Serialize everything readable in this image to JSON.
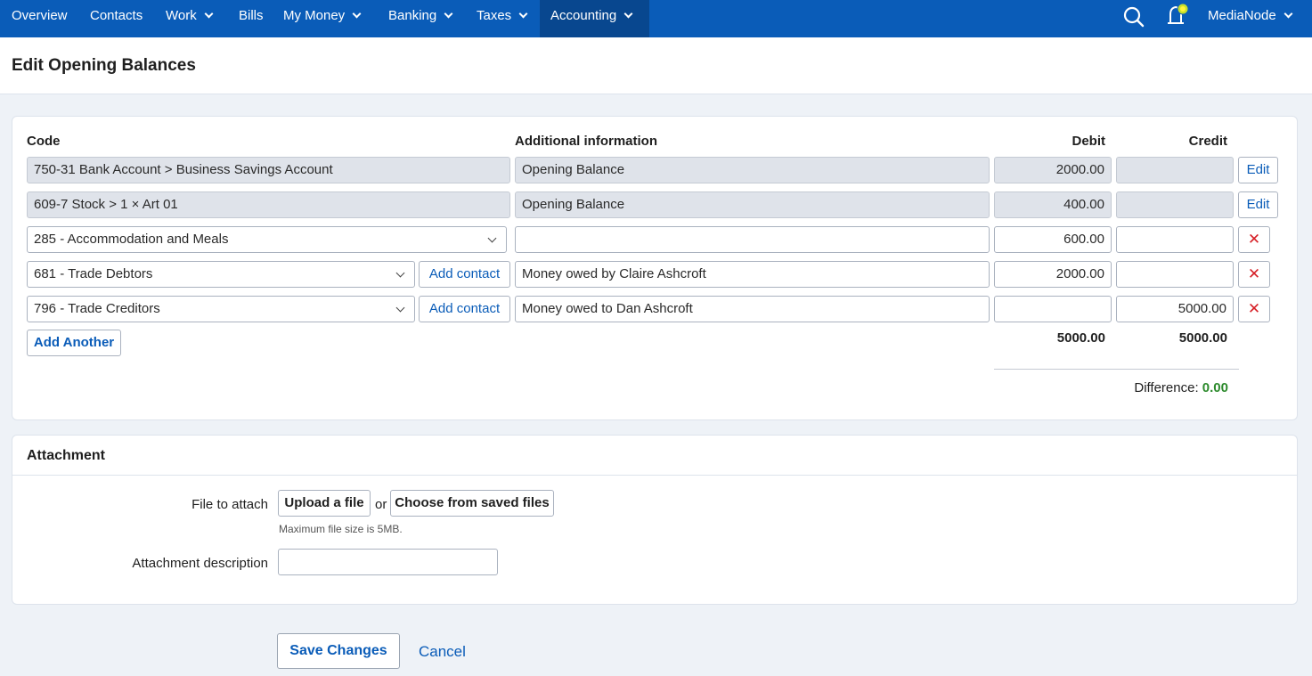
{
  "nav": {
    "items": [
      {
        "label": "Overview",
        "dropdown": false
      },
      {
        "label": "Contacts",
        "dropdown": false
      },
      {
        "label": "Work",
        "dropdown": true
      },
      {
        "label": "Bills",
        "dropdown": false
      },
      {
        "label": "My Money",
        "dropdown": true
      },
      {
        "label": "Banking",
        "dropdown": true
      },
      {
        "label": "Taxes",
        "dropdown": true
      },
      {
        "label": "Accounting",
        "dropdown": true,
        "active": true
      }
    ],
    "account": "MediaNode"
  },
  "page": {
    "title": "Edit Opening Balances"
  },
  "balances": {
    "headers": {
      "code": "Code",
      "info": "Additional information",
      "debit": "Debit",
      "credit": "Credit"
    },
    "rows": [
      {
        "code": "750-31 Bank Account  >  Business Savings Account",
        "info": "Opening Balance",
        "debit": "2000.00",
        "credit": "",
        "action": "Edit"
      },
      {
        "code": "609-7 Stock  >  1 × Art 01",
        "info": "Opening Balance",
        "debit": "400.00",
        "credit": "",
        "action": "Edit"
      },
      {
        "code": "285 - Accommodation and Meals",
        "info": "",
        "debit": "600.00",
        "credit": "",
        "action": "✕"
      },
      {
        "code": "681 - Trade Debtors",
        "contact": "Add contact",
        "info": "Money owed by Claire Ashcroft",
        "debit": "2000.00",
        "credit": "",
        "action": "✕"
      },
      {
        "code": "796 - Trade Creditors",
        "contact": "Add contact",
        "info": "Money owed to Dan Ashcroft",
        "debit": "",
        "credit": "5000.00",
        "action": "✕"
      }
    ],
    "add_another": "Add Another",
    "total_debit": "5000.00",
    "total_credit": "5000.00",
    "difference_label": "Difference:",
    "difference_value": "0.00"
  },
  "attachment": {
    "title": "Attachment",
    "file_label": "File to attach",
    "upload": "Upload a file",
    "or": "or",
    "choose_saved": "Choose from saved files",
    "hint": "Maximum file size is 5MB.",
    "desc_label": "Attachment description",
    "desc_value": ""
  },
  "actions": {
    "save": "Save Changes",
    "cancel": "Cancel"
  },
  "colors": {
    "nav_bg": "#0a5cb8",
    "nav_active": "#08478f",
    "link": "#0a5cb8",
    "remove": "#d61f26",
    "difference_ok": "#2c8a2c"
  }
}
